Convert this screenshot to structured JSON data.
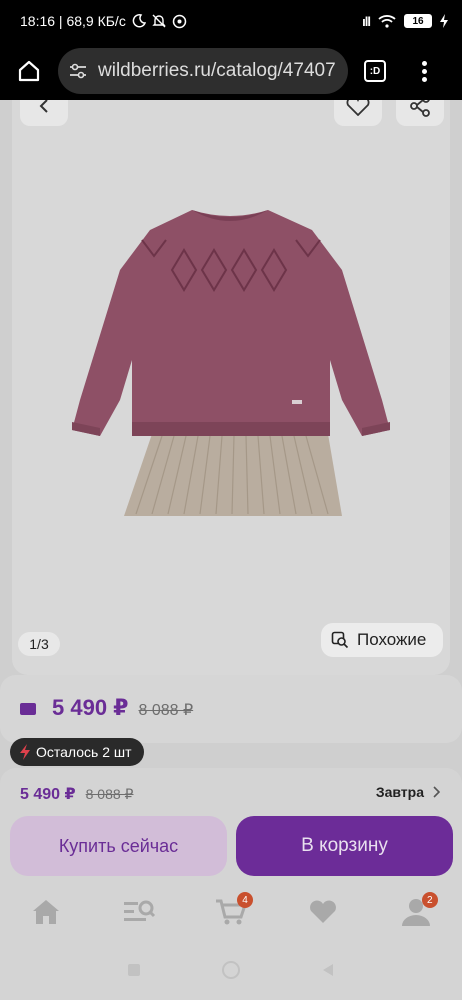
{
  "status_bar": {
    "time_speed": "18:16 | 68,9 КБ/с",
    "signal": "ıll",
    "battery": "16"
  },
  "browser": {
    "url": "wildberries.ru/catalog/47407",
    "tabs_label": ":D"
  },
  "gallery": {
    "counter": "1/3",
    "similar_label": "Похожие"
  },
  "price": {
    "current": "5 490 ₽",
    "old": "8 088 ₽"
  },
  "stock": {
    "label": "Осталось 2 шт"
  },
  "sheet": {
    "price_current": "5 490 ₽",
    "price_old": "8 088 ₽",
    "delivery": "Завтра",
    "buy_now": "Купить сейчас",
    "add_to_cart": "В корзину"
  },
  "tabbar": {
    "items": [
      {
        "icon": "home-icon"
      },
      {
        "icon": "catalog-search-icon"
      },
      {
        "icon": "cart-icon",
        "badge": "4"
      },
      {
        "icon": "heart-icon"
      },
      {
        "icon": "profile-icon",
        "badge": "2"
      }
    ]
  },
  "colors": {
    "accent": "#6c2c98",
    "badge": "#c9502e"
  }
}
